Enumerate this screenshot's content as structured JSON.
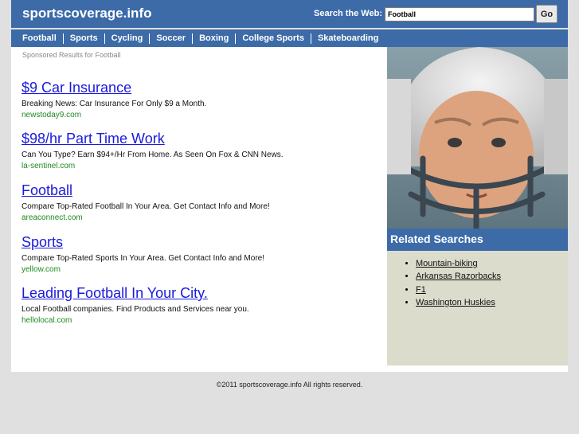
{
  "header": {
    "site_title": "sportscoverage.info",
    "search_label": "Search the Web:",
    "search_value": "Football",
    "go_label": "Go"
  },
  "nav": {
    "items": [
      "Football",
      "Sports",
      "Cycling",
      "Soccer",
      "Boxing",
      "College Sports",
      "Skateboarding"
    ]
  },
  "main": {
    "sponsored_label": "Sponsored Results for Football",
    "ads": [
      {
        "title": "$9 Car Insurance",
        "desc": "Breaking News: Car Insurance For Only $9 a Month.",
        "url": "newstoday9.com"
      },
      {
        "title": "$98/hr Part Time Work",
        "desc": "Can You Type? Earn $94+/Hr From Home. As Seen On Fox & CNN News.",
        "url": "la-sentinel.com"
      },
      {
        "title": "Football",
        "desc": "Compare Top-Rated Football In Your Area. Get Contact Info and More!",
        "url": "areaconnect.com"
      },
      {
        "title": "Sports",
        "desc": "Compare Top-Rated Sports In Your Area. Get Contact Info and More!",
        "url": "yellow.com"
      },
      {
        "title": "Leading Football In Your City.",
        "desc": "Local Football companies. Find Products and Services near you.",
        "url": "hellolocal.com"
      }
    ]
  },
  "sidebar": {
    "related_title": "Related Searches",
    "related": [
      "Mountain-biking",
      "Arkansas Razorbacks",
      "F1",
      "Washington Huskies"
    ]
  },
  "footer": {
    "text": "©2011 sportscoverage.info All rights reserved."
  },
  "colors": {
    "brand_blue": "#3c6ba8",
    "link_blue": "#1a1add",
    "url_green": "#1f8a1f",
    "sidebar_bg": "#dcdccc"
  }
}
